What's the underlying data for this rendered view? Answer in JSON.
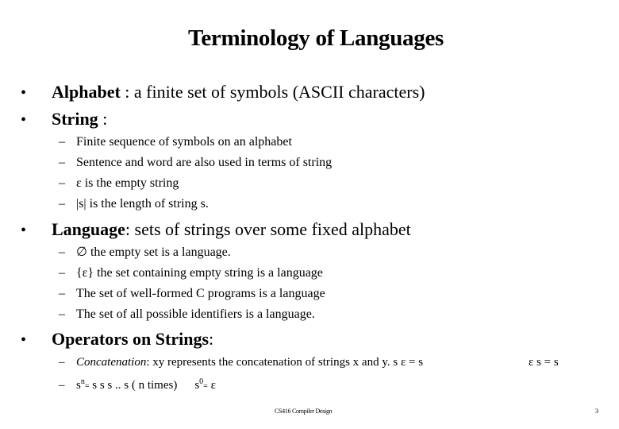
{
  "slide": {
    "title": "Terminology of Languages",
    "bullets": [
      {
        "bullet_glyph": "•",
        "term": "Alphabet",
        "text": " : a finite set of symbols  (ASCII characters)"
      },
      {
        "bullet_glyph": "•",
        "term": "String",
        "text": " :",
        "subitems": [
          "Finite sequence of symbols on an alphabet",
          "Sentence and word are also used in terms of string",
          "ε  is the empty string",
          "|s| is the length of string s."
        ]
      },
      {
        "bullet_glyph": "•",
        "term": "Language",
        "text": ": sets of strings over some fixed alphabet",
        "subitems": [
          "∅ the empty set is a language.",
          "{ε} the set containing empty string is a language",
          "The set of well-formed C programs is a language",
          "The set of all possible identifiers is a language."
        ]
      },
      {
        "bullet_glyph": "•",
        "term": "Operators on Strings",
        "text": ":",
        "subitems_concat": {
          "label": "Concatenation",
          "text": ":  xy represents the concatenation of strings x and y.  s ε = s",
          "right_text": "ε s = s"
        },
        "subitems_power": {
          "base": "s",
          "exp_n": "n",
          "eq": "=",
          "rhs": " s s s .. s ( n times)",
          "base0": "s",
          "exp_0": "0",
          "rhs0": " ε"
        }
      }
    ],
    "dash_glyph": "–",
    "footer": {
      "course": "CS416 Compiler Design",
      "page_number": "3"
    }
  }
}
